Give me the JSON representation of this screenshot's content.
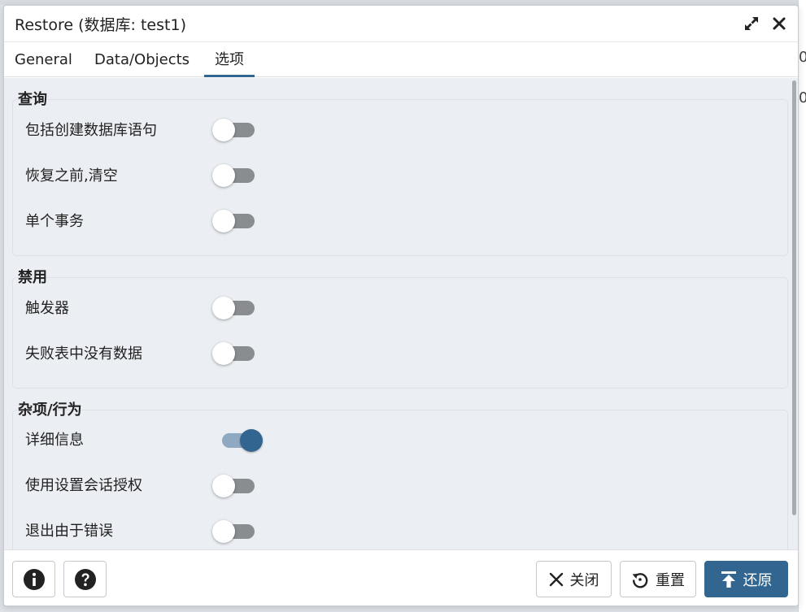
{
  "dialog": {
    "title": "Restore (数据库: test1)",
    "icons": {
      "maximize": "expand-arrows-icon",
      "close": "close-x-icon"
    }
  },
  "tabs": [
    {
      "label": "General",
      "active": false
    },
    {
      "label": "Data/Objects",
      "active": false
    },
    {
      "label": "选项",
      "active": true
    }
  ],
  "sections": {
    "query": {
      "title": "查询",
      "rows": [
        {
          "label": "包括创建数据库语句",
          "on": false
        },
        {
          "label": "恢复之前,清空",
          "on": false
        },
        {
          "label": "单个事务",
          "on": false
        }
      ]
    },
    "disable": {
      "title": "禁用",
      "rows": [
        {
          "label": "触发器",
          "on": false
        },
        {
          "label": "失败表中没有数据",
          "on": false
        }
      ]
    },
    "misc": {
      "title": "杂项/行为",
      "rows": [
        {
          "label": "详细信息",
          "on": true
        },
        {
          "label": "使用设置会话授权",
          "on": false
        },
        {
          "label": "退出由于错误",
          "on": false
        }
      ]
    }
  },
  "footer": {
    "info_icon": "info-circle-icon",
    "help_icon": "question-circle-icon",
    "close_label": "关闭",
    "reset_label": "重置",
    "restore_label": "还原"
  },
  "colors": {
    "accent": "#326690",
    "switch_off": "#8a8d90",
    "switch_on_track": "#8fa9c2",
    "panel_bg": "#ebeef2"
  }
}
